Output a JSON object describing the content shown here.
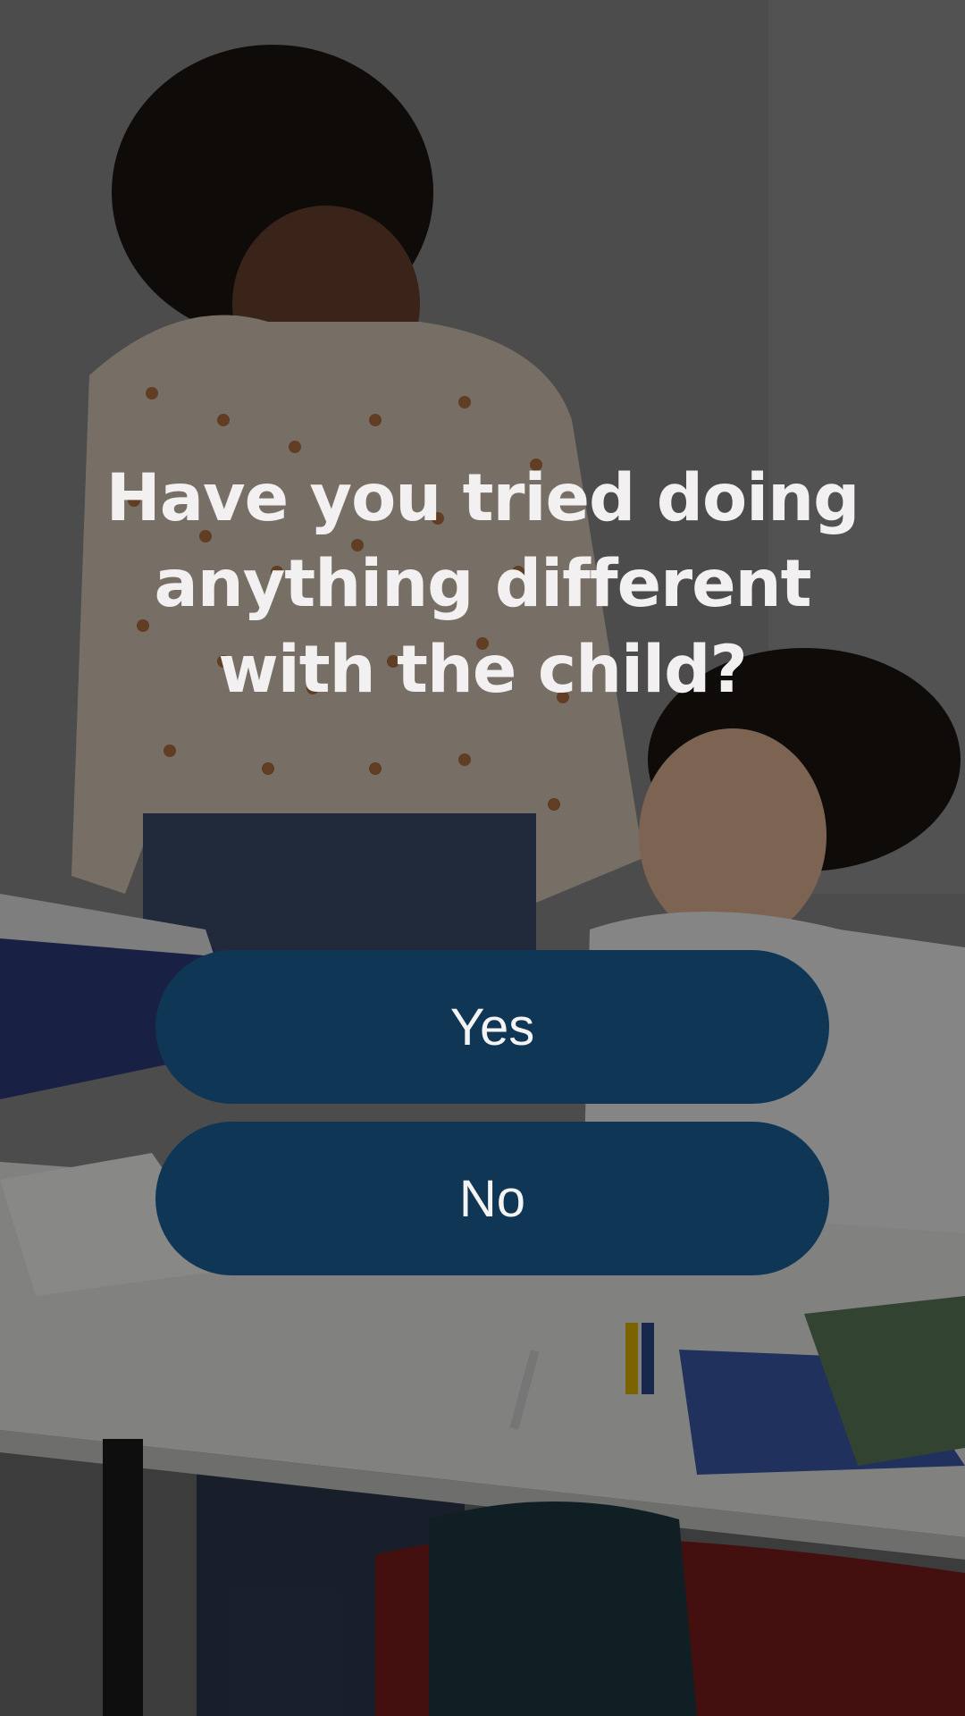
{
  "background": {
    "description_icon": "classroom-photo",
    "overlay_color": "#000000"
  },
  "question": {
    "text": "Have you tried doing anything different with the child?"
  },
  "answers": [
    {
      "label": "Yes"
    },
    {
      "label": "No"
    }
  ],
  "colors": {
    "button_bg": "#0f3654",
    "text": "#f2f0f0"
  }
}
